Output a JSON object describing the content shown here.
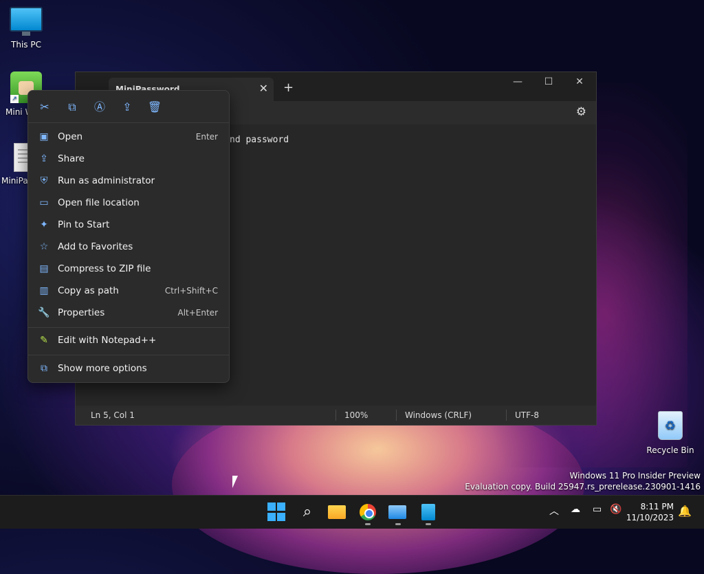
{
  "desktop": {
    "icons": [
      {
        "label": "This PC"
      },
      {
        "label": "Mini W"
      },
      {
        "label": "MiniPa"
      },
      {
        "label": "Recycle Bin"
      }
    ],
    "watermark": {
      "line1": "Windows 11 Pro Insider Preview",
      "line2": "Evaluation copy. Build 25947.rs_prerelease.230901-1416"
    }
  },
  "notepad": {
    "tab_title": "MiniPassword",
    "new_tab": "+",
    "editor_visible_text": "nd password",
    "status": {
      "position": "Ln 5, Col 1",
      "zoom": "100%",
      "line_ending": "Windows (CRLF)",
      "encoding": "UTF-8"
    }
  },
  "context_menu": {
    "quick_actions": [
      "cut-icon",
      "copy-icon",
      "rename-icon",
      "share-icon",
      "delete-icon"
    ],
    "items": [
      {
        "label": "Open",
        "shortcut": "Enter",
        "icon": "open-icon"
      },
      {
        "label": "Share",
        "shortcut": "",
        "icon": "share-icon"
      },
      {
        "label": "Run as administrator",
        "shortcut": "",
        "icon": "shield-icon"
      },
      {
        "label": "Open file location",
        "shortcut": "",
        "icon": "folder-icon"
      },
      {
        "label": "Pin to Start",
        "shortcut": "",
        "icon": "pin-icon"
      },
      {
        "label": "Add to Favorites",
        "shortcut": "",
        "icon": "star-icon"
      },
      {
        "label": "Compress to ZIP file",
        "shortcut": "",
        "icon": "zip-icon"
      },
      {
        "label": "Copy as path",
        "shortcut": "Ctrl+Shift+C",
        "icon": "path-icon"
      },
      {
        "label": "Properties",
        "shortcut": "Alt+Enter",
        "icon": "wrench-icon"
      }
    ],
    "extra": {
      "label": "Edit with Notepad++",
      "icon": "notepadpp-icon"
    },
    "more": {
      "label": "Show more options",
      "icon": "more-options-icon"
    }
  },
  "taskbar": {
    "apps": [
      "start-icon",
      "search-icon",
      "file-explorer-icon",
      "chrome-icon",
      "remote-desktop-icon",
      "notepad-icon"
    ],
    "clock": {
      "time": "8:11 PM",
      "date": "11/10/2023"
    }
  },
  "colors": {
    "accent": "#3ab0ff",
    "menu_bg": "#2b2b2b",
    "window_bg": "#272727"
  }
}
